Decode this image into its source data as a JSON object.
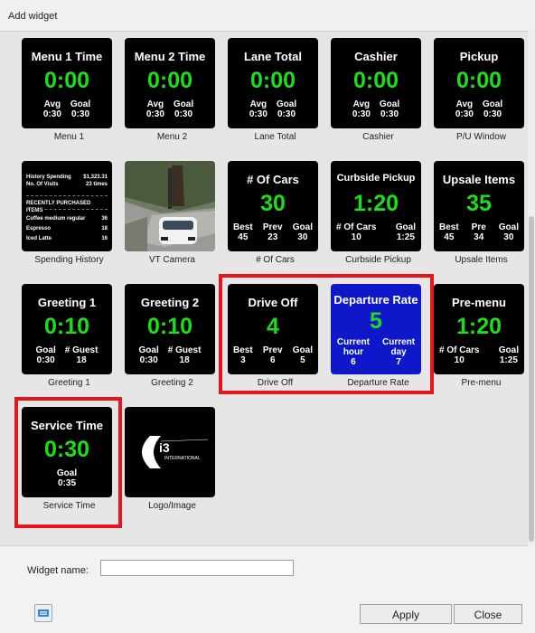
{
  "window": {
    "title": "Add widget"
  },
  "colors": {
    "tile_bg": "#000000",
    "value_green": "#19e019",
    "departure_blue": "#0e18c8",
    "selection_red": "#e8141c"
  },
  "widgets": {
    "menu1": {
      "title": "Menu 1 Time",
      "value": "0:00",
      "s1_label": "Avg",
      "s1_val": "0:30",
      "s2_label": "Goal",
      "s2_val": "0:30",
      "caption": "Menu 1"
    },
    "menu2": {
      "title": "Menu 2 Time",
      "value": "0:00",
      "s1_label": "Avg",
      "s1_val": "0:30",
      "s2_label": "Goal",
      "s2_val": "0:30",
      "caption": "Menu 2"
    },
    "lane_total": {
      "title": "Lane Total",
      "value": "0:00",
      "s1_label": "Avg",
      "s1_val": "0:30",
      "s2_label": "Goal",
      "s2_val": "0:30",
      "caption": "Lane Total"
    },
    "cashier": {
      "title": "Cashier",
      "value": "0:00",
      "s1_label": "Avg",
      "s1_val": "0:30",
      "s2_label": "Goal",
      "s2_val": "0:30",
      "caption": "Cashier"
    },
    "pickup": {
      "title": "Pickup",
      "value": "0:00",
      "s1_label": "Avg",
      "s1_val": "0:30",
      "s2_label": "Goal",
      "s2_val": "0:30",
      "caption": "P/U Window"
    },
    "spending": {
      "line1_label": "History Spending",
      "line1_val": "$1,323.31",
      "line2_label": "No. Of Visits",
      "line2_val": "23 times",
      "header": "RECENTLY PURCHASED ITEMS",
      "items": [
        {
          "name": "Coffee medium regular",
          "count": "36"
        },
        {
          "name": "Espresso",
          "count": "18"
        },
        {
          "name": "Iced Latte",
          "count": "16"
        }
      ],
      "caption": "Spending History"
    },
    "camera": {
      "caption": "VT Camera"
    },
    "num_cars": {
      "title": "# Of Cars",
      "value": "30",
      "s1_label": "Best",
      "s1_val": "45",
      "s2_label": "Prev",
      "s2_val": "23",
      "s3_label": "Goal",
      "s3_val": "30",
      "caption": "# Of Cars"
    },
    "curbside": {
      "title": "Curbside Pickup",
      "value": "1:20",
      "s1_label": "# Of Cars",
      "s1_val": "10",
      "s2_label": "Goal",
      "s2_val": "1:25",
      "caption": "Curbside Pickup"
    },
    "upsale": {
      "title": "Upsale Items",
      "value": "35",
      "s1_label": "Best",
      "s1_val": "45",
      "s2_label": "Pre",
      "s2_val": "34",
      "s3_label": "Goal",
      "s3_val": "30",
      "caption": "Upsale Items"
    },
    "greeting1": {
      "title": "Greeting 1",
      "value": "0:10",
      "s1_label": "Goal",
      "s1_val": "0:30",
      "s2_label": "# Guest",
      "s2_val": "18",
      "caption": "Greeting 1"
    },
    "greeting2": {
      "title": "Greeting 2",
      "value": "0:10",
      "s1_label": "Goal",
      "s1_val": "0:30",
      "s2_label": "# Guest",
      "s2_val": "18",
      "caption": "Greeting 2"
    },
    "drive_off": {
      "title": "Drive Off",
      "value": "4",
      "s1_label": "Best",
      "s1_val": "3",
      "s2_label": "Prev",
      "s2_val": "6",
      "s3_label": "Goal",
      "s3_val": "5",
      "caption": "Drive Off"
    },
    "departure": {
      "title": "Departure Rate",
      "value": "5",
      "s1_label": "Current\nhour",
      "s1_val": "6",
      "s2_label": "Current\nday",
      "s2_val": "7",
      "caption": "Departure Rate"
    },
    "premenu": {
      "title": "Pre-menu",
      "value": "1:20",
      "s1_label": "# Of Cars",
      "s1_val": "10",
      "s2_label": "Goal",
      "s2_val": "1:25",
      "caption": "Pre-menu"
    },
    "service": {
      "title": "Service Time",
      "value": "0:30",
      "s1_label": "Goal",
      "s1_val": "0:35",
      "caption": "Service Time"
    },
    "logo": {
      "mark": "i3",
      "text": "INTERNATIONAL",
      "caption": "Logo/Image"
    }
  },
  "form": {
    "name_label": "Widget name:",
    "name_value": ""
  },
  "buttons": {
    "apply": "Apply",
    "close": "Close",
    "icon": "keyboard-icon"
  }
}
